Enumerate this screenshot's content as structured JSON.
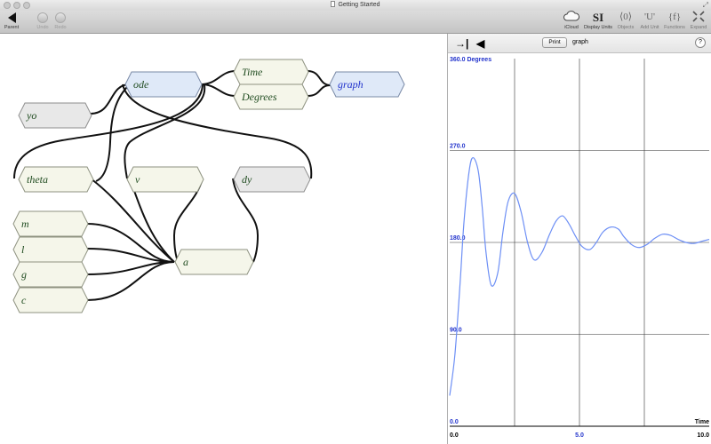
{
  "window": {
    "title": "Getting Started"
  },
  "toolbar": {
    "parent": "Parent",
    "undo": "Undo",
    "redo": "Redo",
    "icloud": "iCloud",
    "si_icon": "SI",
    "display_units": "Display Units",
    "objects_icon": "⟨0⟩",
    "objects": "Objects",
    "add_unit_icon": "'U'",
    "add_unit": "Add Unit",
    "functions_icon": "{f}",
    "functions": "Functions",
    "expand": "Expand"
  },
  "nodes": {
    "ode": "ode",
    "time": "Time",
    "degrees": "Degrees",
    "graph": "graph",
    "yo": "yo",
    "theta": "theta",
    "v": "v",
    "dy": "dy",
    "m": "m",
    "l": "l",
    "g": "g",
    "c": "c",
    "a": "a"
  },
  "graph_panel": {
    "print": "Print",
    "name": "graph",
    "help": "?"
  },
  "colors": {
    "series": "#6d8ff5",
    "axis_label": "#2233cc"
  },
  "chart_data": {
    "type": "line",
    "x_label": "Time",
    "y_label": "Degrees",
    "xlim": [
      0.0,
      10.0
    ],
    "ylim": [
      0.0,
      360.0
    ],
    "x_ticks": [
      0.0,
      5.0,
      10.0
    ],
    "y_ticks": [
      0.0,
      90.0,
      180.0,
      270.0,
      360.0
    ],
    "x_tick_labels": [
      "0.0",
      "5.0",
      "10.0"
    ],
    "y_tick_labels": [
      "0.0",
      "90.0",
      "180.0",
      "270.0",
      "360.0 Degrees"
    ],
    "series": [
      {
        "x": [
          0.0,
          0.2,
          0.4,
          0.55,
          0.75,
          0.9,
          1.1,
          1.25,
          1.4,
          1.6,
          1.85,
          2.05,
          2.25,
          2.5,
          2.75,
          3.0,
          3.25,
          3.55,
          3.85,
          4.1,
          4.35,
          4.6,
          4.85,
          5.1,
          5.4,
          5.65,
          5.9,
          6.2,
          6.5,
          6.7,
          7.0,
          7.3,
          7.6,
          7.9,
          8.2,
          8.5,
          8.8,
          9.1,
          9.4,
          9.7,
          10.0
        ],
        "y": [
          30,
          70,
          140,
          200,
          250,
          263,
          250,
          215,
          170,
          138,
          150,
          190,
          220,
          228,
          210,
          180,
          163,
          170,
          188,
          201,
          206,
          198,
          186,
          176,
          173,
          180,
          190,
          195,
          193,
          186,
          178,
          175,
          178,
          184,
          188,
          187,
          183,
          180,
          179,
          181,
          183
        ]
      }
    ]
  }
}
